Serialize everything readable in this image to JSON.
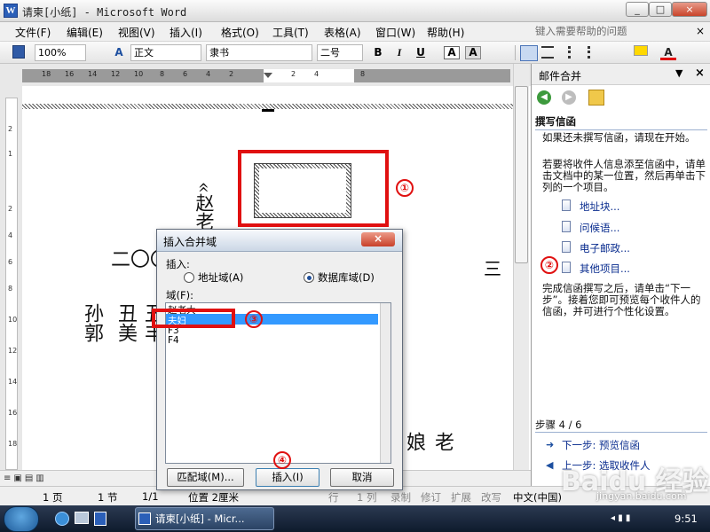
{
  "window": {
    "title": "请柬[小纸] - Microsoft Word",
    "controls": [
      "_",
      "□",
      "×"
    ]
  },
  "menu": {
    "items": [
      "文件(F)",
      "编辑(E)",
      "视图(V)",
      "插入(I)",
      "格式(O)",
      "工具(T)",
      "表格(A)",
      "窗口(W)",
      "帮助(H)"
    ],
    "help_placeholder": "键入需要帮助的问题",
    "close": "×"
  },
  "toolbar": {
    "zoom": "100%",
    "style": "正文",
    "font": "隶书",
    "size": "二号",
    "bold": "B",
    "italic": "I",
    "underline": "U",
    "caps": "A",
    "font_color_letter": "A",
    "underline_color": "#e00000"
  },
  "ruler": {
    "numbers": [
      "18",
      "16",
      "14",
      "12",
      "10",
      "8",
      "6",
      "4",
      "2",
      "",
      "2",
      "4",
      "",
      "8"
    ],
    "vnumbers": [
      "2",
      "1",
      "2",
      "4",
      "6",
      "8",
      "10",
      "12",
      "14",
      "16",
      "18"
    ]
  },
  "document": {
    "field_text": "«赵老大»",
    "col_yr": "二〇〇",
    "names": [
      "孙郭",
      "丑美",
      "丑丰"
    ],
    "bottom_text": "老娘",
    "right_char": "三"
  },
  "status": {
    "page": "1 页",
    "section": "1 节",
    "pages": "1/1",
    "position": "位置 2厘米",
    "row": "行",
    "col": "1 列",
    "rec": "录制",
    "rev": "修订",
    "ext": "扩展",
    "ovr": "改写",
    "lang": "中文(中国)"
  },
  "pane": {
    "title": "邮件合并",
    "section_title": "撰写信函",
    "para1": "如果还未撰写信函，请现在开始。",
    "para2": "若要将收件人信息添至信函中，请单击文档中的某一位置，然后再单击下列的一个项目。",
    "links": [
      "地址块...",
      "问候语...",
      "电子邮政...",
      "其他项目..."
    ],
    "para3": "完成信函撰写之后，请单击“下一步”。接着您即可预览每个收件人的信函，并可进行个性化设置。",
    "step": "步骤 4 / 6",
    "next": "下一步: 预览信函",
    "prev": "上一步: 选取收件人"
  },
  "dialog": {
    "title": "插入合并域",
    "insert_label": "插入:",
    "radio_address": "地址域(A)",
    "radio_database": "数据库域(D)",
    "field_label": "域(F):",
    "fields": [
      "赵老大",
      "夫妇",
      "F3",
      "F4"
    ],
    "selected_index": 1,
    "btn_match": "匹配域(M)...",
    "btn_insert": "插入(I)",
    "btn_cancel": "取消",
    "close": "×"
  },
  "annotations": [
    "①",
    "②",
    "③",
    "④"
  ],
  "taskbar": {
    "button": "请柬[小纸] - Micr...",
    "time": "9:51"
  },
  "watermark": {
    "text": "Baidu 经验",
    "url": "jingyan.baidu.com"
  }
}
